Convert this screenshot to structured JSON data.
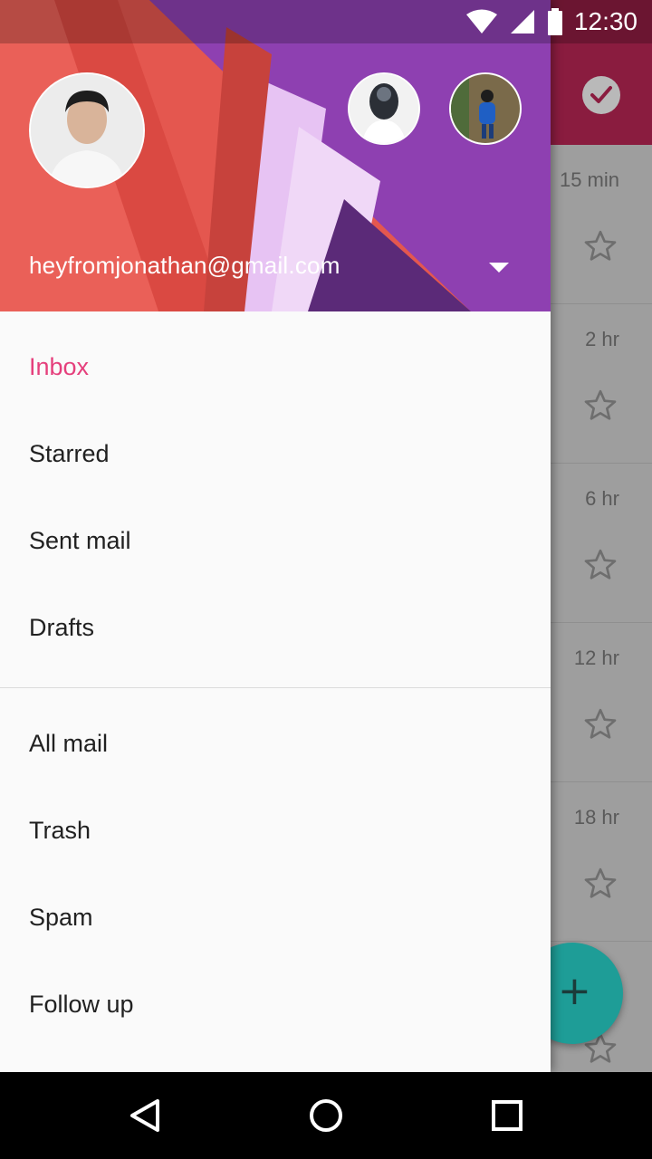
{
  "status_bar": {
    "time": "12:30",
    "icons": [
      "wifi-icon",
      "cell-signal-icon",
      "battery-icon"
    ]
  },
  "drawer": {
    "account": {
      "email": "heyfromjonathan@gmail.com"
    },
    "sections": [
      {
        "items": [
          {
            "label": "Inbox",
            "active": true
          },
          {
            "label": "Starred"
          },
          {
            "label": "Sent mail"
          },
          {
            "label": "Drafts"
          }
        ]
      },
      {
        "items": [
          {
            "label": "All mail"
          },
          {
            "label": "Trash"
          },
          {
            "label": "Spam"
          },
          {
            "label": "Follow up"
          }
        ]
      }
    ]
  },
  "background_list": {
    "times": [
      "15 min",
      "2 hr",
      "6 hr",
      "12 hr",
      "18 hr"
    ]
  },
  "fab": {
    "label": "+"
  },
  "colors": {
    "accent": "#e53f7c",
    "header_purple": "#8e3fb0",
    "header_red": "#e5554f",
    "fab": "#1e9d97",
    "toolbar": "#8a1c3f"
  },
  "nav_bar": {
    "icons": [
      "back-icon",
      "home-icon",
      "recents-icon"
    ]
  }
}
